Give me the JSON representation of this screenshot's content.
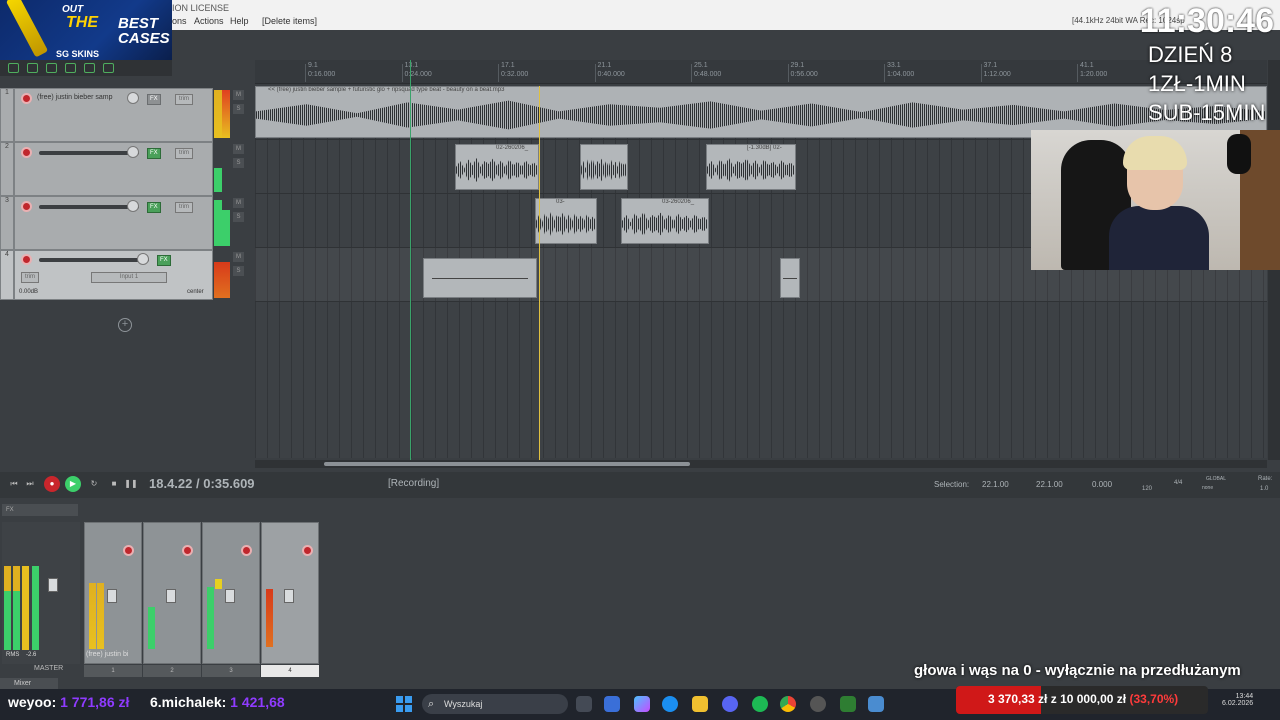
{
  "app": {
    "license_text": "ION LICENSE",
    "menu": [
      "ons",
      "Actions",
      "Help",
      "[Delete items]"
    ],
    "audio_info": "[44.1kHz 24bit WA",
    "audio_info_2": "Rec: 1024sp"
  },
  "logo": {
    "line1": "OUT",
    "line2": "THE",
    "line3": "BEST CASES",
    "line4": "SG SKINS"
  },
  "ruler": {
    "bars": [
      {
        "bar": "9.1",
        "time": "0:16.000"
      },
      {
        "bar": "13.1",
        "time": "0:24.000"
      },
      {
        "bar": "17.1",
        "time": "0:32.000"
      },
      {
        "bar": "21.1",
        "time": "0:40.000"
      },
      {
        "bar": "25.1",
        "time": "0:48.000"
      },
      {
        "bar": "29.1",
        "time": "0:56.000"
      },
      {
        "bar": "33.1",
        "time": "1:04.000"
      },
      {
        "bar": "37.1",
        "time": "1:12.000"
      },
      {
        "bar": "41.1",
        "time": "1:20.000"
      }
    ]
  },
  "tracks": [
    {
      "num": "1",
      "name": "(free) justin bieber samp",
      "fx": "FX",
      "trim": "trim"
    },
    {
      "num": "2",
      "name": "",
      "fx": "FX",
      "trim": "trim"
    },
    {
      "num": "3",
      "name": "",
      "fx": "FX",
      "trim": "trim"
    },
    {
      "num": "4",
      "name": "",
      "fx": "FX",
      "trim": "trim",
      "input": "Input 1",
      "volume": "0.00dB",
      "pan": "center"
    }
  ],
  "items": {
    "main_sample": "<< (free) justin bieber sample + futuristic glo + ripsquad type beat - beauty on a beat.mp3",
    "item_a": "02-260206_",
    "item_b": "[-1.30dB] 02-",
    "item_c": "03-",
    "item_d": "03-260206_"
  },
  "transport": {
    "time": "18.4.22 / 0:35.609",
    "status": "[Recording]",
    "selection_label": "Selection:",
    "sel_start": "22.1.00",
    "sel_end": "22.1.00",
    "sel_len": "0.000",
    "bpm": "120",
    "timesig": "4/4",
    "global": "GLOBAL",
    "none": "none",
    "rate_label": "Rate:",
    "rate": "1.0"
  },
  "mixer": {
    "master": "MASTER",
    "strip1_name": "(free) justin bi",
    "strip_nums": [
      "1",
      "2",
      "3",
      "4"
    ],
    "rms": "RMS",
    "rms_val": "-2.6",
    "tab": "Mixer"
  },
  "overlay": {
    "clock": "11:30:46",
    "day": "DZIEŃ 8",
    "rate1": "1ZŁ-1MIN",
    "rate2": "SUB-15MIN",
    "ticker": "głowa i wąs na 0 - wyłącznie na przedłużanym"
  },
  "taskbar": {
    "donor1_name": "weyoo:",
    "donor1_amt": "1 771,86 zł",
    "donor2_name": "6.michalek:",
    "donor2_amt": "1 421,68",
    "search_placeholder": "Wyszukaj",
    "goal_current": "3 370,33 zł",
    "goal_target": "10 000,00 zł",
    "goal_pct": "(33,70%)",
    "goal_fraction": 0.337,
    "time": "13:44",
    "date": "6.02.2026"
  }
}
